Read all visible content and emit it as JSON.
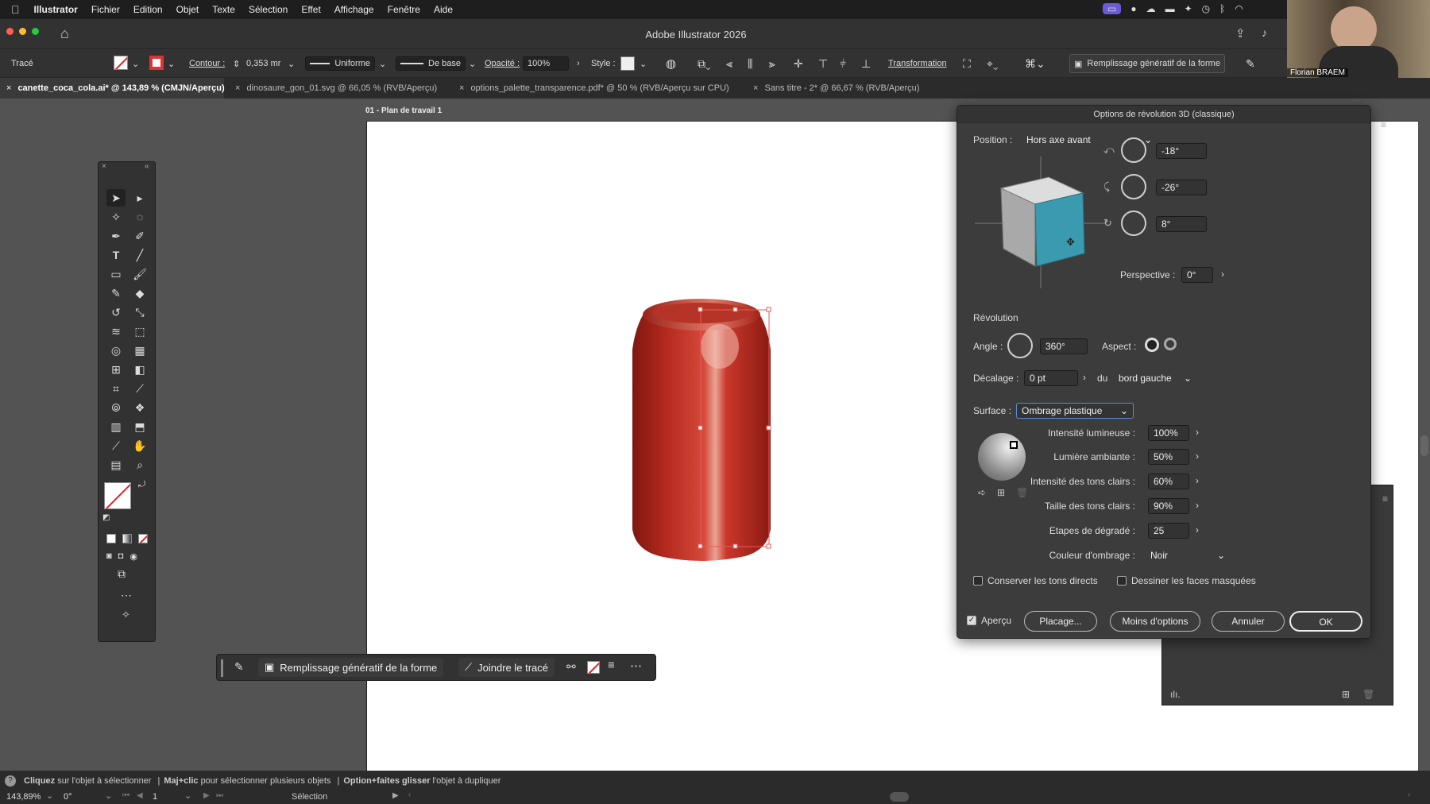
{
  "menubar": {
    "apple": "",
    "app": "Illustrator",
    "items": [
      "Fichier",
      "Edition",
      "Objet",
      "Texte",
      "Sélection",
      "Effet",
      "Affichage",
      "Fenêtre",
      "Aide"
    ]
  },
  "window": {
    "title": "Adobe Illustrator 2026"
  },
  "control": {
    "object_type": "Tracé",
    "stroke_label": "Contour :",
    "stroke_value": "0,353 mr",
    "stroke_profile": "Uniforme",
    "brush": "De base",
    "opacity_label": "Opacité :",
    "opacity_value": "100%",
    "style_label": "Style :",
    "transform_label": "Transformation",
    "generative": "Remplissage génératif de la forme"
  },
  "tabs": [
    {
      "label": "canette_coca_cola.ai* @ 143,89 % (CMJN/Aperçu)"
    },
    {
      "label": "dinosaure_gon_01.svg @ 66,05 % (RVB/Aperçu)"
    },
    {
      "label": "options_palette_transparence.pdf* @ 50 % (RVB/Aperçu sur CPU)"
    },
    {
      "label": "Sans titre - 2* @ 66,67 % (RVB/Aperçu)"
    }
  ],
  "artboard": {
    "label": "01 - Plan de travail 1"
  },
  "context": {
    "generative": "Remplissage génératif de la forme",
    "join": "Joindre le tracé"
  },
  "dialog": {
    "title": "Options de révolution 3D (classique)",
    "position_label": "Position :",
    "position_value": "Hors axe avant",
    "rot_x": "-18°",
    "rot_y": "-26°",
    "rot_z": "8°",
    "perspective_label": "Perspective :",
    "perspective_value": "0°",
    "revolution_label": "Révolution",
    "angle_label": "Angle :",
    "angle_value": "360°",
    "aspect_label": "Aspect :",
    "offset_label": "Décalage :",
    "offset_value": "0 pt",
    "offset_from": "du",
    "offset_edge": "bord gauche",
    "surface_label": "Surface :",
    "surface_value": "Ombrage plastique",
    "light_intensity_label": "Intensité lumineuse :",
    "light_intensity": "100%",
    "ambient_label": "Lumière ambiante :",
    "ambient": "50%",
    "highlight_intensity_label": "Intensité des tons clairs :",
    "highlight_intensity": "60%",
    "highlight_size_label": "Taille des tons clairs :",
    "highlight_size": "90%",
    "blend_steps_label": "Etapes de dégradé :",
    "blend_steps": "25",
    "shade_color_label": "Couleur d'ombrage :",
    "shade_color": "Noir",
    "preserve_spot": "Conserver les tons directs",
    "draw_hidden": "Dessiner les faces masquées",
    "preview": "Aperçu",
    "map_btn": "Placage...",
    "fewer_btn": "Moins d'options",
    "cancel_btn": "Annuler",
    "ok_btn": "OK"
  },
  "status": {
    "h1": "Cliquez",
    "t1": "sur l'objet à sélectionner",
    "h2": "Maj+clic",
    "t2": "pour sélectionner plusieurs objets",
    "h3": "Option+faites glisser",
    "t3": "l'objet à dupliquer",
    "zoom": "143,89%",
    "rotation": "0°",
    "page": "1",
    "tool": "Sélection"
  },
  "webcam": {
    "name": "Florian BRAEM"
  },
  "colors": {
    "can_red": "#b3261e",
    "cube_blue": "#3a9bb0",
    "accent": "#2a6ac8"
  }
}
